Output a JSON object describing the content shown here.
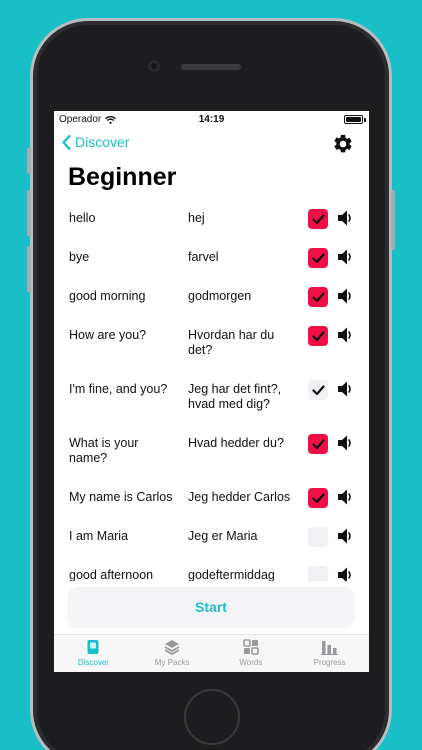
{
  "status": {
    "carrier": "Operador",
    "time": "14:19"
  },
  "nav": {
    "back_label": "Discover"
  },
  "title": "Beginner",
  "colors": {
    "accent": "#19bfc6",
    "checked": "#f00e44",
    "background": "#19bfc6"
  },
  "words": [
    {
      "word": "hello",
      "translation": "hej",
      "state": "checked",
      "height": 39
    },
    {
      "word": "bye",
      "translation": "farvel",
      "state": "checked",
      "height": 39
    },
    {
      "word": "good morning",
      "translation": "godmorgen",
      "state": "checked",
      "height": 39
    },
    {
      "word": "How are you?",
      "translation": "Hvordan har du det?",
      "state": "checked",
      "height": 54
    },
    {
      "word": "I'm fine, and you?",
      "translation": "Jeg har det fint?, hvad med dig?",
      "state": "checkmark",
      "height": 54
    },
    {
      "word": "What is your name?",
      "translation": "Hvad hedder du?",
      "state": "checked",
      "height": 54
    },
    {
      "word": "My name is Carlos",
      "translation": "Jeg hedder Carlos",
      "state": "checked",
      "height": 39
    },
    {
      "word": "I am Maria",
      "translation": "Jeg er Maria",
      "state": "unchecked",
      "height": 39
    },
    {
      "word": "good afternoon",
      "translation": "godeftermiddag",
      "state": "unchecked",
      "height": 39
    }
  ],
  "start_label": "Start",
  "tabs": [
    {
      "label": "Discover",
      "icon": "book-icon",
      "active": true
    },
    {
      "label": "My Packs",
      "icon": "layers-icon",
      "active": false
    },
    {
      "label": "Words",
      "icon": "grid-icon",
      "active": false
    },
    {
      "label": "Progress",
      "icon": "bar-chart-icon",
      "active": false
    }
  ]
}
